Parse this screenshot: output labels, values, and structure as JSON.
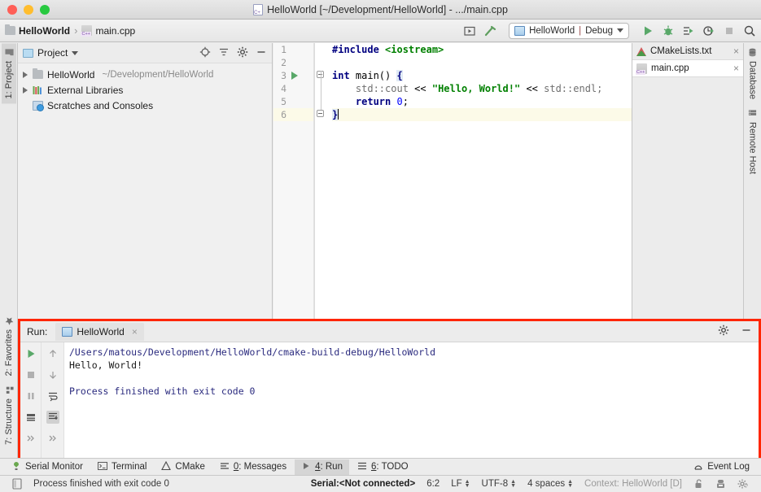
{
  "titlebar": {
    "title": "HelloWorld [~/Development/HelloWorld] - .../main.cpp",
    "icon": "cpp-file-icon"
  },
  "navbar": {
    "breadcrumb": [
      {
        "label": "HelloWorld",
        "icon": "folder-icon"
      },
      {
        "label": "main.cpp",
        "icon": "cpp-file-icon"
      }
    ],
    "separator": "›",
    "icons": [
      "run-widget-icon",
      "build-hammer-icon"
    ],
    "run_config": {
      "name": "HelloWorld",
      "separator": "|",
      "mode": "Debug",
      "icon": "run-config-icon",
      "caret": "chevron-down-icon"
    },
    "actions": [
      "run-icon",
      "debug-icon",
      "run-with-coverage-icon",
      "profile-icon",
      "stop-icon",
      "search-icon"
    ]
  },
  "left_tabs": [
    {
      "label": "1: Project",
      "active": true,
      "icon": "project-folder-icon"
    },
    {
      "label": "2: Favorites",
      "active": false,
      "icon": "star-icon"
    },
    {
      "label": "7: Structure",
      "active": false,
      "icon": "structure-icon"
    }
  ],
  "right_tabs": [
    {
      "label": "Database",
      "icon": "database-icon"
    },
    {
      "label": "Remote Host",
      "icon": "remote-host-icon"
    }
  ],
  "project_panel": {
    "title": "Project",
    "caret": "chevron-down-icon",
    "tools": [
      "locate-icon",
      "collapse-all-icon",
      "settings-gear-icon",
      "hide-icon"
    ],
    "tree": [
      {
        "label": "HelloWorld",
        "path": "~/Development/HelloWorld",
        "icon": "folder-icon",
        "arrow": true,
        "indent": 0
      },
      {
        "label": "External Libraries",
        "path": "",
        "icon": "libraries-icon",
        "arrow": true,
        "indent": 0
      },
      {
        "label": "Scratches and Consoles",
        "path": "",
        "icon": "scratches-icon",
        "arrow": false,
        "indent": 0
      }
    ]
  },
  "editor": {
    "line_numbers": [
      "1",
      "2",
      "3",
      "4",
      "5",
      "6"
    ],
    "current_line": 6,
    "run_marker_line": 3,
    "inspection_status": "✓",
    "code": [
      {
        "n": 1,
        "tokens": [
          {
            "t": "#include ",
            "c": "k-pre"
          },
          {
            "t": "<iostream>",
            "c": "k-inc"
          }
        ]
      },
      {
        "n": 2,
        "tokens": []
      },
      {
        "n": 3,
        "tokens": [
          {
            "t": "int",
            "c": "k-kw"
          },
          {
            "t": " main() ",
            "c": "k-fn"
          },
          {
            "t": "{",
            "c": "brace-hl"
          }
        ]
      },
      {
        "n": 4,
        "tokens": [
          {
            "t": "    std::cout ",
            "c": "k-ns"
          },
          {
            "t": "<< ",
            "c": "k-op"
          },
          {
            "t": "\"Hello, World!\"",
            "c": "k-str"
          },
          {
            "t": " << ",
            "c": "k-op"
          },
          {
            "t": "std::endl;",
            "c": "k-ns"
          }
        ]
      },
      {
        "n": 5,
        "tokens": [
          {
            "t": "    return",
            "c": "k-kw"
          },
          {
            "t": " ",
            "c": "k-op"
          },
          {
            "t": "0",
            "c": "k-num"
          },
          {
            "t": ";",
            "c": "k-op"
          }
        ]
      },
      {
        "n": 6,
        "tokens": [
          {
            "t": "}",
            "c": "brace-hl"
          }
        ]
      }
    ]
  },
  "file_tabs": [
    {
      "label": "CMakeLists.txt",
      "icon": "cmake-icon",
      "close": "×",
      "active": false
    },
    {
      "label": "main.cpp",
      "icon": "cpp-file-icon",
      "close": "×",
      "active": true
    }
  ],
  "run_panel": {
    "label": "Run:",
    "tab": {
      "label": "HelloWorld",
      "icon": "run-config-icon",
      "close": "×"
    },
    "tools": [
      "settings-gear-icon",
      "hide-icon"
    ],
    "left_buttons": [
      "rerun-icon",
      "stop-icon",
      "pause-icon",
      "print-icon",
      "expand-more-icon"
    ],
    "right_buttons": [
      "up-icon",
      "down-icon",
      "soft-wrap-icon",
      "scroll-to-end-icon",
      "expand-more-icon"
    ],
    "console": [
      {
        "text": "/Users/matous/Development/HelloWorld/cmake-build-debug/HelloWorld",
        "style": "cons-sys"
      },
      {
        "text": "Hello, World!",
        "style": "cons-out"
      },
      {
        "text": "",
        "style": "cons-out"
      },
      {
        "text": "Process finished with exit code 0",
        "style": "cons-sys"
      }
    ]
  },
  "tool_windows": [
    {
      "label": "Serial Monitor",
      "icon": "serial-monitor-icon",
      "active": false,
      "mnemonic": ""
    },
    {
      "label": "Terminal",
      "icon": "terminal-icon",
      "active": false,
      "mnemonic": ""
    },
    {
      "label": "CMake",
      "icon": "cmake-icon",
      "active": false,
      "mnemonic": ""
    },
    {
      "label": "Messages",
      "icon": "messages-icon",
      "active": false,
      "mnemonic": "0"
    },
    {
      "label": "Run",
      "icon": "run-icon",
      "active": true,
      "mnemonic": "4"
    },
    {
      "label": "TODO",
      "icon": "todo-icon",
      "active": false,
      "mnemonic": "6"
    },
    {
      "label": "Event Log",
      "icon": "event-log-icon",
      "active": false,
      "mnemonic": ""
    }
  ],
  "statusbar": {
    "left_icon": "toggle-toolbar-icon",
    "message": "Process finished with exit code 0",
    "serial": "Serial:<Not connected>",
    "caret_position": "6:2",
    "line_separator": "LF",
    "encoding": "UTF-8",
    "indent": "4 spaces",
    "context": "Context: HelloWorld [D]",
    "icons": [
      "lock-icon",
      "git-branch-icon",
      "settings-help-icon"
    ]
  }
}
